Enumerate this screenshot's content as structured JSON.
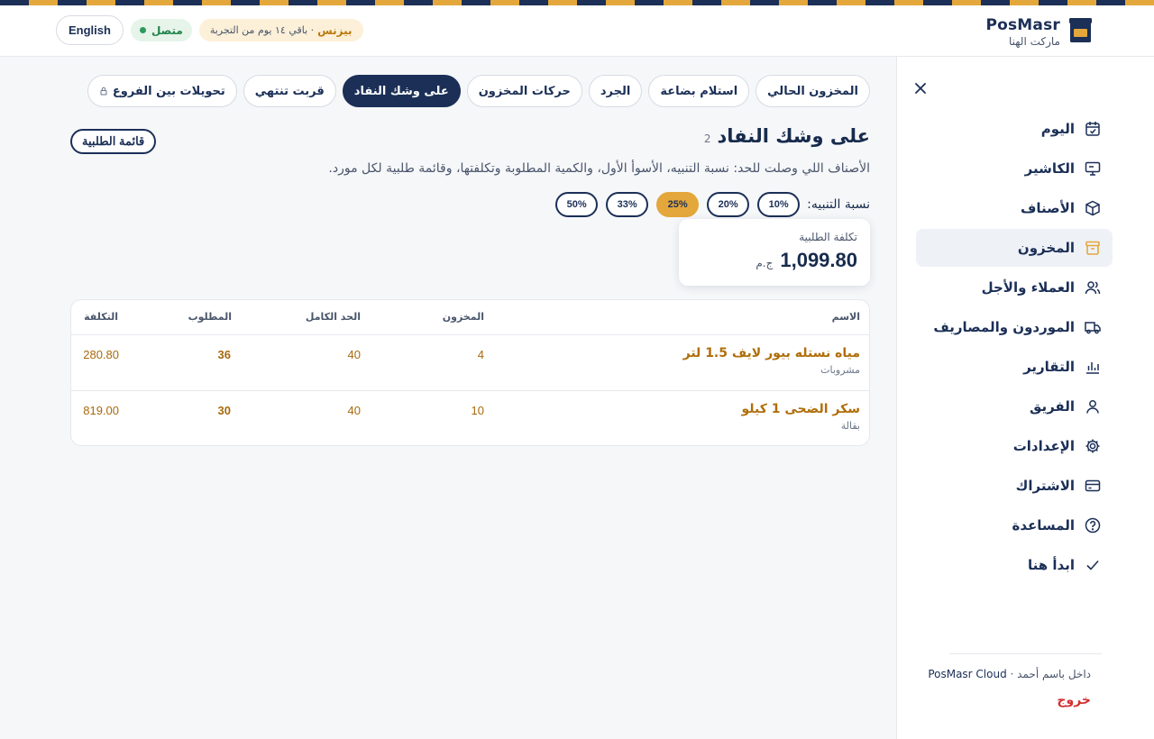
{
  "brand": {
    "name": "PosMasr",
    "store": "ماركت الهنا"
  },
  "header": {
    "language_button": "English",
    "status": "متصل",
    "trial_plan": "بيزنس",
    "trial_text": "· باقي ١٤ يوم من التجربة"
  },
  "sidebar": {
    "items": [
      {
        "label": "اليوم",
        "icon": "calendar-check-icon"
      },
      {
        "label": "الكاشير",
        "icon": "monitor-icon"
      },
      {
        "label": "الأصناف",
        "icon": "box-icon"
      },
      {
        "label": "المخزون",
        "icon": "archive-icon",
        "active": true
      },
      {
        "label": "العملاء والأجل",
        "icon": "users-icon"
      },
      {
        "label": "الموردون والمصاريف",
        "icon": "truck-icon"
      },
      {
        "label": "التقارير",
        "icon": "bar-chart-icon"
      },
      {
        "label": "الفريق",
        "icon": "user-icon"
      },
      {
        "label": "الإعدادات",
        "icon": "gear-icon"
      },
      {
        "label": "الاشتراك",
        "icon": "credit-card-icon"
      },
      {
        "label": "المساعدة",
        "icon": "help-circle-icon"
      },
      {
        "label": "ابدأ هنا",
        "icon": "check-icon"
      }
    ],
    "signed_in": "داخل باسم أحمد ·",
    "cloud": "PosMasr Cloud",
    "logout": "خروج"
  },
  "tabs": [
    {
      "label": "المخزون الحالي"
    },
    {
      "label": "استلام بضاعة"
    },
    {
      "label": "الجرد"
    },
    {
      "label": "حركات المخزون"
    },
    {
      "label": "على وشك النفاد",
      "active": true
    },
    {
      "label": "قربت تنتهي"
    },
    {
      "label": "تحويلات بين الفروع",
      "locked": true
    }
  ],
  "page": {
    "title": "على وشك النفاد",
    "count": "2",
    "order_list_button": "قائمة الطلبية",
    "description": "الأصناف اللي وصلت للحد: نسبة التنبيه، الأسوأ الأول، والكمية المطلوبة وتكلفتها، وقائمة طلبية لكل مورد."
  },
  "alert_ratio": {
    "label": "نسبة التنبيه:",
    "options": [
      "10%",
      "20%",
      "25%",
      "33%",
      "50%"
    ],
    "selected": "25%"
  },
  "order_cost": {
    "label": "تكلفة الطلبية",
    "currency": "ج.م",
    "value": "1,099.80"
  },
  "table": {
    "headers": {
      "name": "الاسم",
      "stock": "المخزون",
      "max": "الحد الكامل",
      "needed": "المطلوب",
      "cost": "التكلفة"
    },
    "rows": [
      {
        "name": "مياه نستله بيور لايف 1.5 لتر",
        "category": "مشروبات",
        "stock": "4",
        "max": "40",
        "needed": "36",
        "cost": "280.80"
      },
      {
        "name": "سكر الضحى 1 كيلو",
        "category": "بقالة",
        "stock": "10",
        "max": "40",
        "needed": "30",
        "cost": "819.00"
      }
    ]
  },
  "colors": {
    "navy": "#1b2f57",
    "gold": "#e3a73b",
    "danger": "#d32f2f",
    "amber_text": "#b06e0a"
  }
}
